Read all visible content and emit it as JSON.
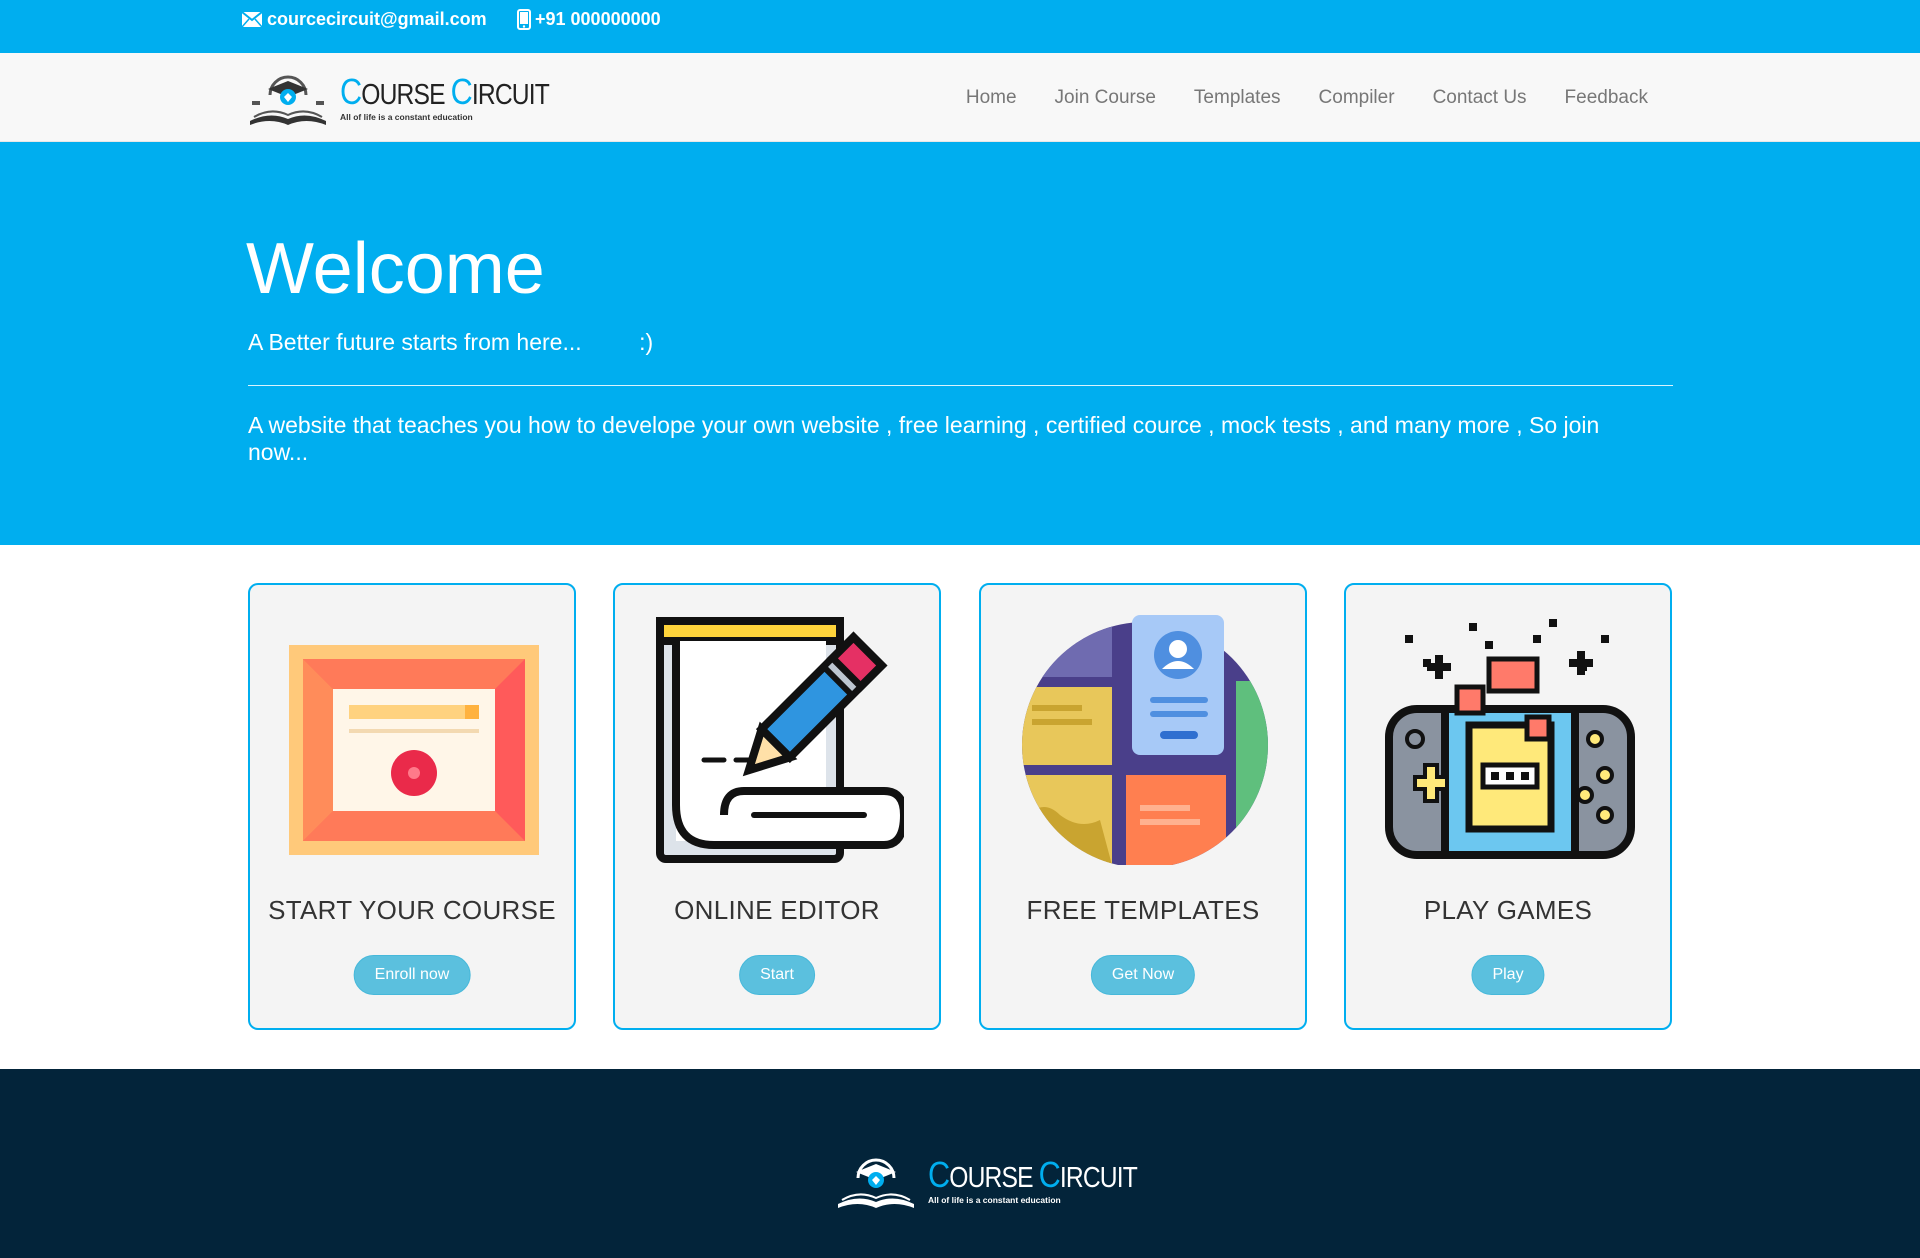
{
  "topbar": {
    "email": "courcecircuit@gmail.com",
    "phone": "+91 000000000",
    "email_icon": "envelope-icon",
    "phone_icon": "mobile-phone-icon"
  },
  "brand": {
    "title_c1": "C",
    "title_rest1": "OURSE ",
    "title_c2": "C",
    "title_rest2": "IRCUIT",
    "tagline": "All of life is a constant education"
  },
  "nav": {
    "items": [
      "Home",
      "Join Course",
      "Templates",
      "Compiler",
      "Contact Us",
      "Feedback"
    ]
  },
  "hero": {
    "title": "Welcome",
    "lead": "A Better future starts from here...         :)",
    "description": "A website that teaches you how to develope your own website , free learning , certified cource , mock tests , and many more , So join now..."
  },
  "cards": [
    {
      "title": "START YOUR COURSE",
      "button": "Enroll now",
      "icon": "certificate-icon"
    },
    {
      "title": "ONLINE EDITOR",
      "button": "Start",
      "icon": "pencil-editor-icon"
    },
    {
      "title": "FREE TEMPLATES",
      "button": "Get Now",
      "icon": "templates-icon"
    },
    {
      "title": "PLAY GAMES",
      "button": "Play",
      "icon": "game-console-icon"
    }
  ],
  "colors": {
    "primary": "#00aeef",
    "footer": "#03243a",
    "button": "#5bc0de"
  }
}
